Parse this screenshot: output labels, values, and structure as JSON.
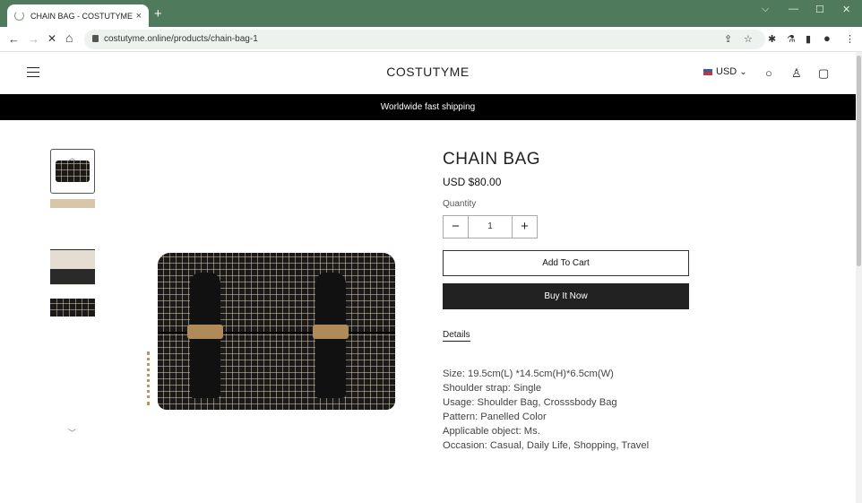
{
  "browser": {
    "tab_title": "CHAIN BAG - COSTUTYME",
    "tab_close": "×",
    "new_tab": "+",
    "url": "costutyme.online/products/chain-bag-1",
    "nav": {
      "back": "←",
      "forward": "→",
      "stop": "✕",
      "home": "⌂"
    },
    "window_controls": {
      "tabsearch": "⌵",
      "minimize": "—",
      "maximize": "☐",
      "close": "✕"
    },
    "ext_icons": {
      "share": "⇪",
      "star": "☆",
      "puzzle": "✱",
      "flask": "⚗",
      "sidepanel": "▮",
      "profile": "●",
      "menu": "⋮"
    }
  },
  "site": {
    "brand": "COSTUTYME",
    "currency": "USD",
    "currency_chevron": "⌄",
    "search_icon": "○",
    "account_icon": "♙",
    "cart_icon": "▢",
    "announcement": "Worldwide fast shipping"
  },
  "gallery": {
    "up": "︿",
    "down": "﹀"
  },
  "product": {
    "title": "CHAIN BAG",
    "price": "USD $80.00",
    "quantity_label": "Quantity",
    "quantity_value": "1",
    "minus": "−",
    "plus": "+",
    "add_to_cart": "Add To Cart",
    "buy_now": "Buy It Now",
    "details_tab": "Details",
    "description": [
      "Size: 19.5cm(L) *14.5cm(H)*6.5cm(W)",
      "Shoulder strap: Single",
      "Usage: Shoulder Bag, Crosssbody Bag",
      "Pattern: Panelled Color",
      "Applicable object: Ms.",
      "Occasion: Casual, Daily Life, Shopping, Travel"
    ]
  }
}
